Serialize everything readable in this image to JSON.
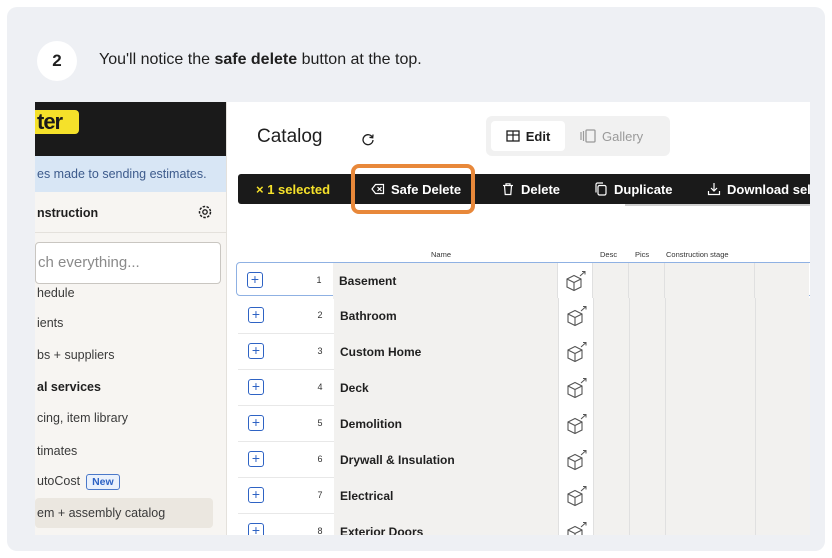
{
  "step": {
    "number": "2",
    "text_before": "You'll notice the ",
    "text_bold": "safe delete",
    "text_after": " button at the top."
  },
  "sidebar": {
    "logo": "ter",
    "notice": "es made to sending estimates.",
    "org_name": "nstruction",
    "search_placeholder": "ch everything...",
    "items": [
      {
        "label": "hedule",
        "bold": false
      },
      {
        "label": "ients",
        "bold": false
      },
      {
        "label": "bs + suppliers",
        "bold": false
      },
      {
        "label": "al services",
        "bold": true
      },
      {
        "label": "cing, item library",
        "bold": false
      },
      {
        "label": "timates",
        "bold": false
      },
      {
        "label": "utoCost",
        "bold": false,
        "badge": "New"
      },
      {
        "label": "em + assembly catalog",
        "bold": false,
        "active": true
      }
    ]
  },
  "header": {
    "title": "Catalog",
    "view_edit": "Edit",
    "view_gallery": "Gallery"
  },
  "toolbar": {
    "selected": "× 1 selected",
    "safe_delete": "Safe Delete",
    "delete": "Delete",
    "duplicate": "Duplicate",
    "download": "Download sel"
  },
  "table": {
    "columns": {
      "name": "Name",
      "desc": "Desc",
      "pics": "Pics",
      "construction_stage": "Construction stage"
    },
    "rows": [
      {
        "num": "1",
        "name": "Basement"
      },
      {
        "num": "2",
        "name": "Bathroom"
      },
      {
        "num": "3",
        "name": "Custom Home"
      },
      {
        "num": "4",
        "name": "Deck"
      },
      {
        "num": "5",
        "name": "Demolition"
      },
      {
        "num": "6",
        "name": "Drywall & Insulation"
      },
      {
        "num": "7",
        "name": "Electrical"
      },
      {
        "num": "8",
        "name": "Exterior Doors"
      }
    ]
  },
  "colors": {
    "accent_yellow": "#f5e12a",
    "highlight_orange": "#e8883a",
    "link_blue": "#2e63c4",
    "toolbar_dark": "#1a1a1a"
  }
}
